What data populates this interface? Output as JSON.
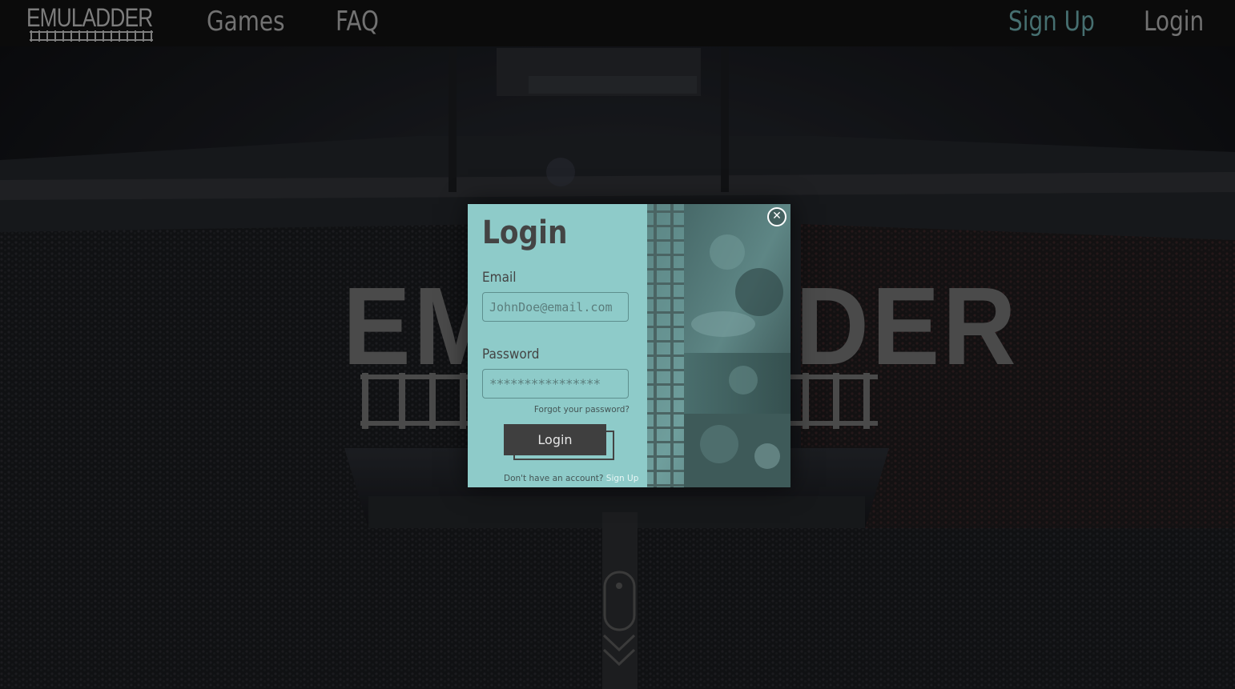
{
  "nav": {
    "logo_text": "EMULADDER",
    "games": "Games",
    "faq": "FAQ",
    "signup": "Sign Up",
    "login": "Login"
  },
  "hero": {
    "title": "EMULADDER"
  },
  "modal": {
    "title": "Login",
    "email_label": "Email",
    "email_placeholder": "JohnDoe@email.com",
    "password_label": "Password",
    "password_value": "****************",
    "forgot": "Forgot your password?",
    "login_button": "Login",
    "no_account": "Don't have an account?",
    "signup_link": "Sign Up",
    "close_icon": "close-icon"
  },
  "colors": {
    "accent_teal": "#8ecbc9",
    "signup_nav": "#466f70",
    "nav_text": "#727272",
    "button_dark": "#3f3f3f",
    "navbar_bg": "#0b0b0b"
  }
}
